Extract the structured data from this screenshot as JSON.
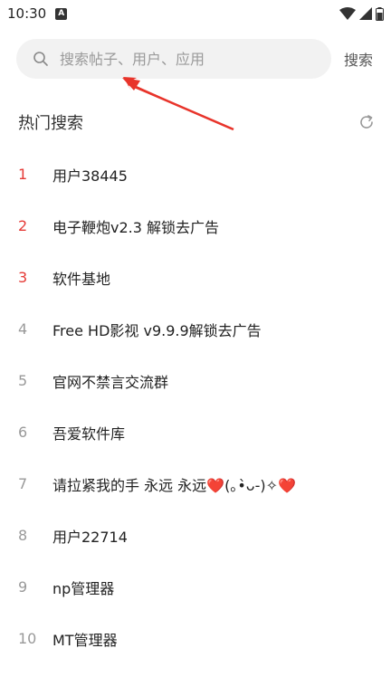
{
  "status_bar": {
    "time": "10:30",
    "notification_icon": "a-badge-icon",
    "icons": [
      "wifi-icon",
      "signal-icon",
      "battery-icon"
    ]
  },
  "search": {
    "placeholder": "搜索帖子、用户、应用",
    "button_label": "搜索"
  },
  "hot": {
    "title": "热门搜索",
    "refresh_icon": "refresh-icon",
    "items": [
      {
        "rank": "1",
        "text": "用户38445"
      },
      {
        "rank": "2",
        "text": "电子鞭炮v2.3 解锁去广告"
      },
      {
        "rank": "3",
        "text": "软件基地"
      },
      {
        "rank": "4",
        "text": "Free HD影视 v9.9.9解锁去广告"
      },
      {
        "rank": "5",
        "text": "官网不禁言交流群"
      },
      {
        "rank": "6",
        "text": "吾爱软件库"
      },
      {
        "rank": "7",
        "text": "请拉紧我的手 永远 永远❤️(｡•̀ᴗ-)✧❤️"
      },
      {
        "rank": "8",
        "text": "用户22714"
      },
      {
        "rank": "9",
        "text": "np管理器"
      },
      {
        "rank": "10",
        "text": "MT管理器"
      }
    ]
  },
  "colors": {
    "accent_rank": "#e53935",
    "annotation_arrow": "#e8342b",
    "search_bg": "#f2f2f2"
  }
}
